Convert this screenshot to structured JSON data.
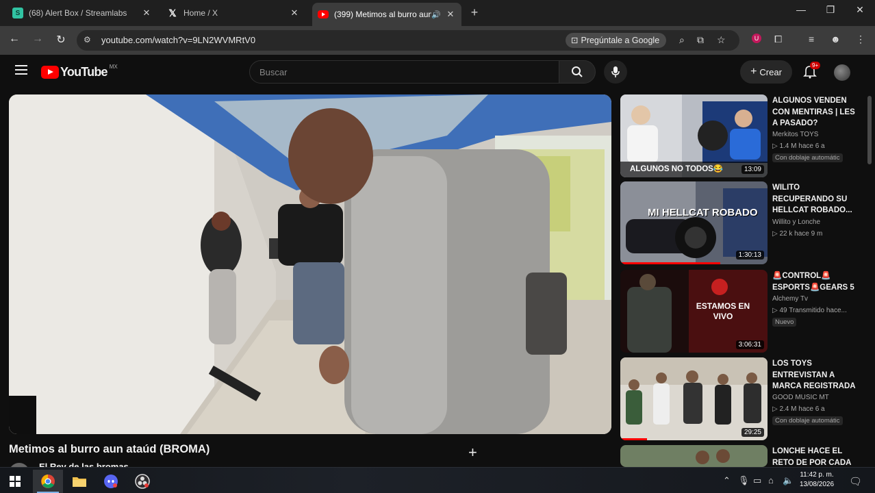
{
  "browser": {
    "tabs": [
      {
        "title": "(68) Alert Box / Streamlabs",
        "icon": "streamlabs-icon"
      },
      {
        "title": "Home / X",
        "icon": "x-logo-icon"
      },
      {
        "title": "(399) Metimos al burro aun",
        "icon": "youtube-icon",
        "active": true
      }
    ],
    "url": "youtube.com/watch?v=9LN2WVMRtV0",
    "ask_google": "Pregúntale a Google"
  },
  "youtube": {
    "logo": "YouTube",
    "country": "MX",
    "search_placeholder": "Buscar",
    "create_label": "Crear",
    "notif_badge": "9+"
  },
  "video": {
    "title": "Metimos al burro aun ataúd (BROMA)",
    "channel": "El Rey de las bromas"
  },
  "recommendations": [
    {
      "title": "ALGUNOS VENDEN CON MENTIRAS | LES A PASADO?",
      "channel": "Merkitos TOYS",
      "meta": "▷ 1.4 M  hace 6 a",
      "tag": "Con doblaje automátic",
      "duration": "13:09",
      "thumb_text": "ALGUNOS NO TODOS😂"
    },
    {
      "title": "WILITO RECUPERANDO SU HELLCAT ROBADO...",
      "channel": "Willito y Lonche",
      "meta": "▷ 22 k  hace 9 m",
      "tag": "",
      "duration": "1:30:13",
      "thumb_text": "MI HELLCAT ROBADO",
      "progress": 0.68
    },
    {
      "title": "🚨CONTROL🚨 ESPORTS🚨GEARS 5",
      "channel": "Alchemy Tv",
      "meta": "▷ 49  Transmitido hace...",
      "tag": "Nuevo",
      "duration": "3:06:31",
      "thumb_text": "ESTAMOS EN VIVO"
    },
    {
      "title": "LOS TOYS ENTREVISTAN A MARCA REGISTRADA",
      "channel": "GOOD MUSIC MT",
      "meta": "▷ 2.4 M  hace 6 a",
      "tag": "Con doblaje automátic",
      "duration": "29:25",
      "thumb_text": "",
      "progress": 0.18
    },
    {
      "title": "LONCHE HACE EL RETO DE POR CADA",
      "channel": "",
      "meta": "",
      "tag": "",
      "duration": "",
      "thumb_text": ""
    }
  ],
  "taskbar": {
    "time": "11:42 p. m.",
    "date": "13/08/2026"
  }
}
